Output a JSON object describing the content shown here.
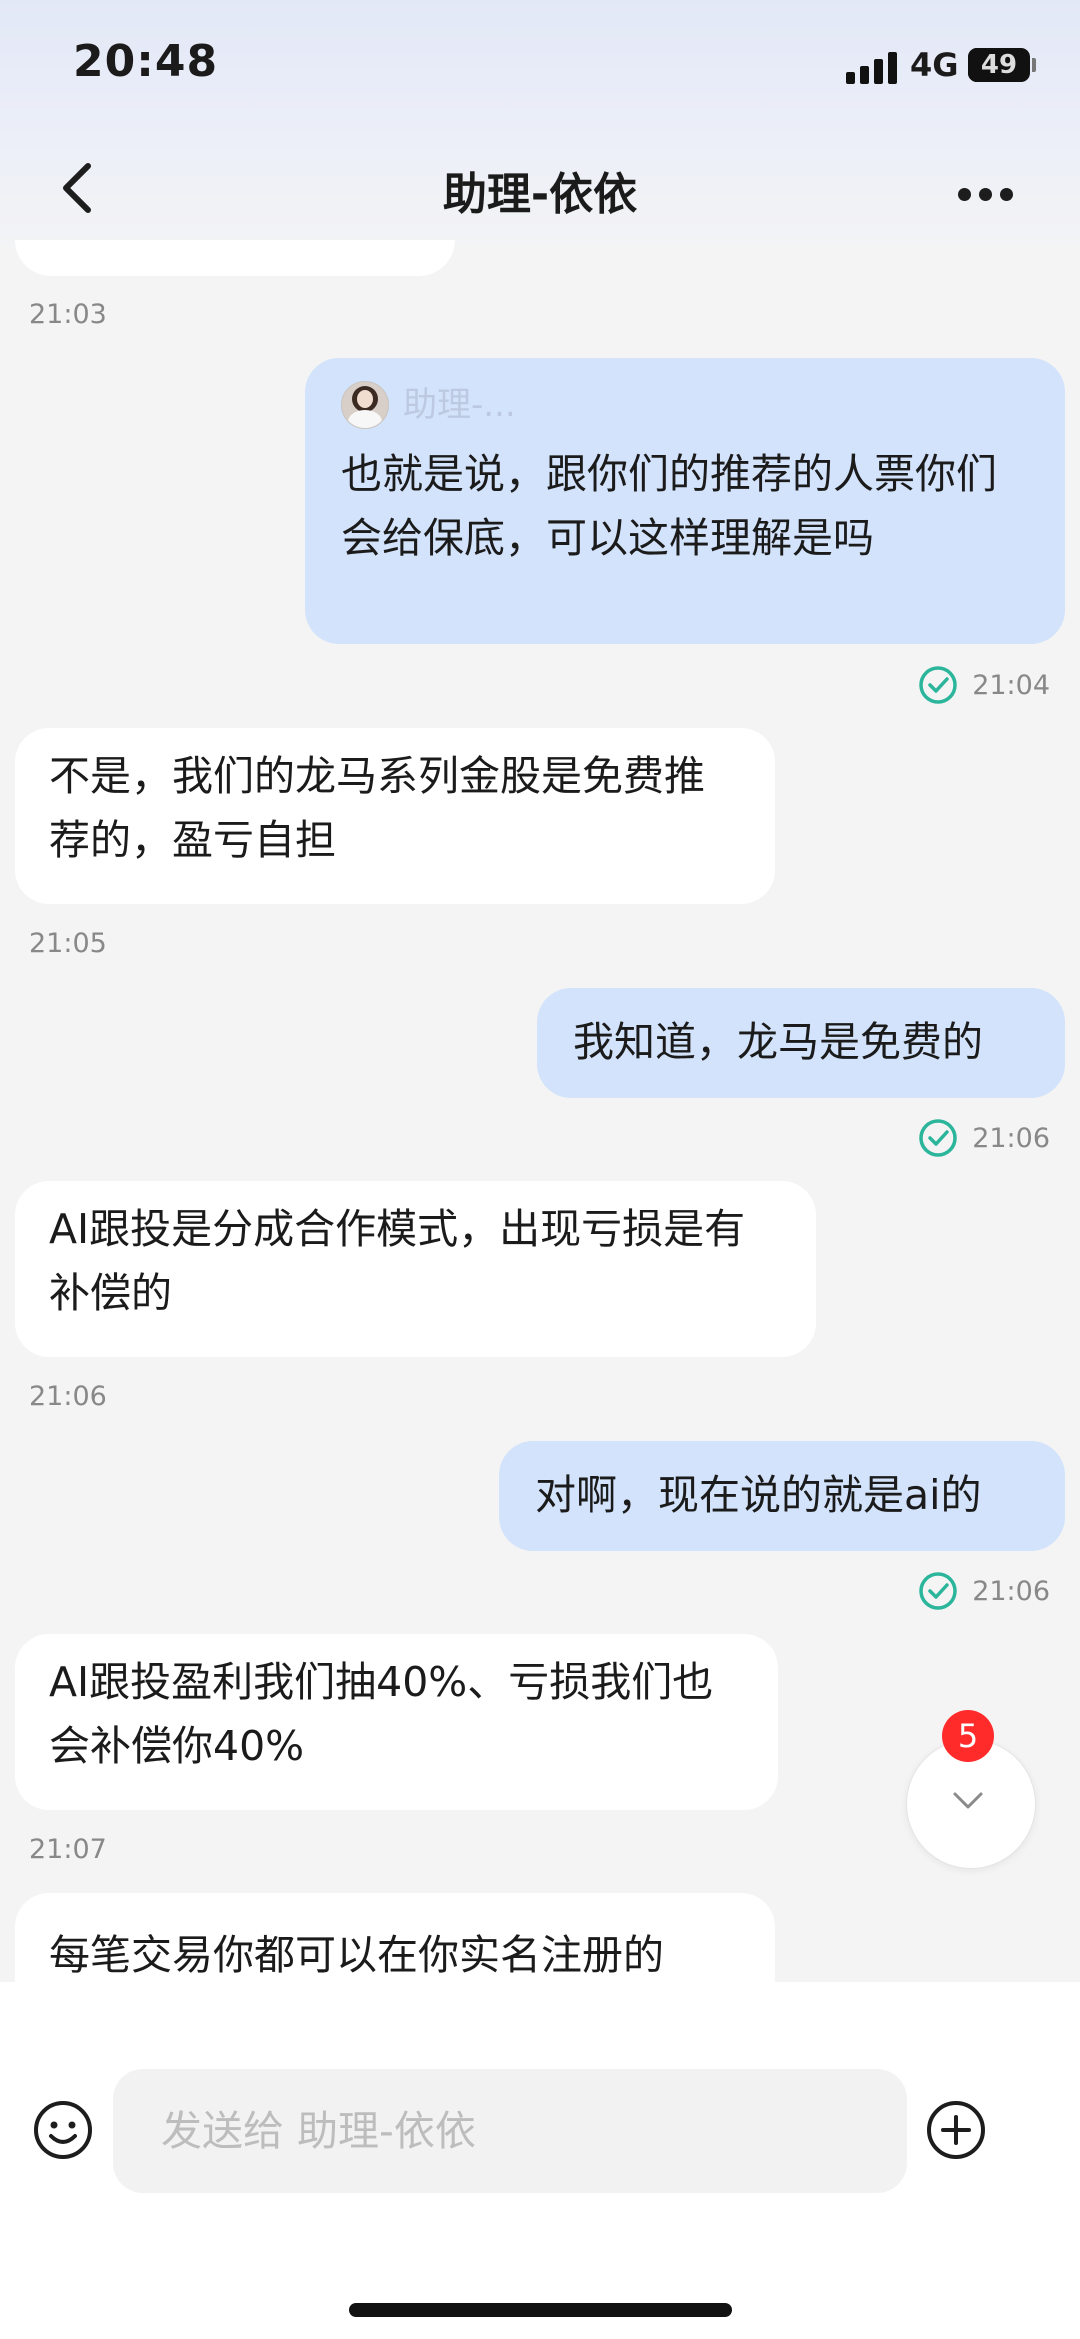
{
  "status_bar": {
    "time": "20:48",
    "network": "4G",
    "battery_level": "49"
  },
  "header": {
    "title": "助理-依依"
  },
  "messages": [
    {
      "kind": "time",
      "text": "21:03"
    },
    {
      "kind": "out",
      "quote_name": "助理-...",
      "text": "也就是说，跟你们的推荐的人票你们会给保底，可以这样理解是吗",
      "time": "21:04",
      "read": true
    },
    {
      "kind": "in",
      "text": "不是，我们的龙马系列金股是免费推荐的，盈亏自担",
      "time": "21:05"
    },
    {
      "kind": "out",
      "text": "我知道，龙马是免费的",
      "time": "21:06",
      "read": true
    },
    {
      "kind": "in",
      "text": "AI跟投是分成合作模式，出现亏损是有补偿的",
      "time": "21:06"
    },
    {
      "kind": "out",
      "text": "对啊，现在说的就是ai的",
      "time": "21:06",
      "read": true
    },
    {
      "kind": "in",
      "text": "AI跟投盈利我们抽40%、亏损我们也会补偿你40%",
      "time": "21:07"
    },
    {
      "kind": "in",
      "text": "每笔交易你都可以在你实名注册的"
    }
  ],
  "scroll_down": {
    "unread_count": "5"
  },
  "composer": {
    "placeholder": "发送给 助理-依依"
  },
  "colors": {
    "outgoing_bubble": "#d3e3fb",
    "incoming_bubble": "#ffffff",
    "read_check": "#2bb59b",
    "badge": "#ff2b2b"
  },
  "icons": [
    "back-icon",
    "more-icon",
    "check-circle-icon",
    "chevron-down-icon",
    "emoji-icon",
    "plus-circle-icon"
  ]
}
